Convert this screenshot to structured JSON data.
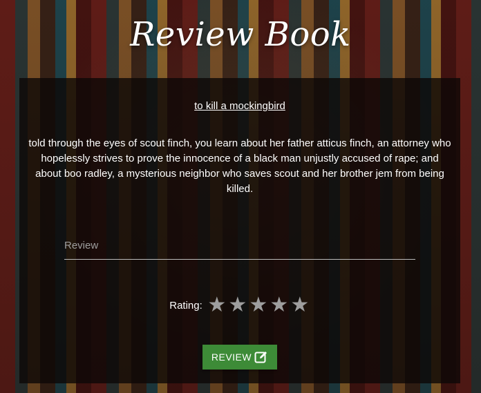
{
  "page": {
    "title": "Review Book"
  },
  "book": {
    "title": "to kill a mockingbird",
    "description": "told through the eyes of scout finch, you learn about her father atticus finch, an attorney who hopelessly strives to prove the innocence of a black man unjustly accused of rape; and about boo radley, a mysterious neighbor who saves scout and her brother jem from being killed."
  },
  "form": {
    "review_placeholder": "Review",
    "review_value": "",
    "rating_label": "Rating:",
    "rating": {
      "value": 0,
      "max": 5,
      "star_glyph": "★"
    },
    "submit_label": "REVIEW",
    "submit_icon": "edit-icon"
  },
  "colors": {
    "button": "#3d8b37",
    "star_inactive": "#9e9e9e",
    "card_bg": "rgba(12,8,6,0.80)"
  }
}
